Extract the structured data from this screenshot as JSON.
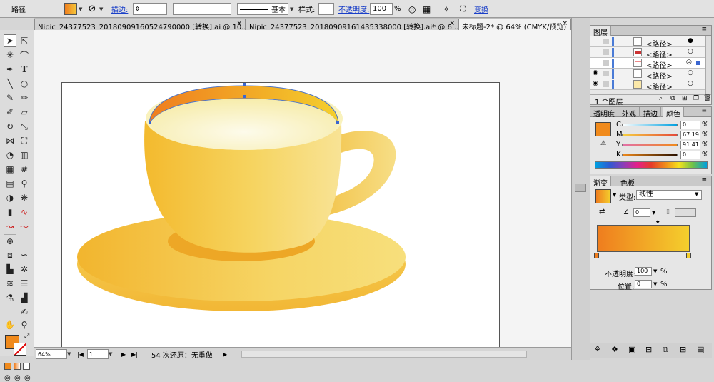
{
  "control_bar": {
    "selection_label": "路径",
    "stroke_link": "描边:",
    "stroke_style": "基本",
    "style_label": "样式:",
    "opacity_link": "不透明度:",
    "opacity_value": "100",
    "opacity_unit": "%",
    "transform_link": "变换"
  },
  "doc_tabs": [
    {
      "label": "Nipic_24377523_20180909160524790000 [转换].ai @ 10...",
      "close": "×"
    },
    {
      "label": "Nipic_24377523_20180909161435338000 [转换].ai* @ 6...",
      "close": "×"
    },
    {
      "label": "未标题-2* @ 64% (CMYK/预览)",
      "close": "×"
    }
  ],
  "status_bar": {
    "zoom": "64%",
    "page": "1",
    "history_text": "54 次还原：无重做"
  },
  "layers_panel": {
    "tab": "图层",
    "rows": [
      "<路径>",
      "<路径>",
      "<路径>",
      "<路径>",
      "<路径>"
    ],
    "footer": "1 个图层"
  },
  "color_panel": {
    "tabs": [
      "透明度",
      "外观",
      "描边",
      "颜色"
    ],
    "channels": [
      {
        "label": "C",
        "value": "0",
        "unit": "%"
      },
      {
        "label": "M",
        "value": "67.19",
        "unit": "%"
      },
      {
        "label": "Y",
        "value": "91.41",
        "unit": "%"
      },
      {
        "label": "K",
        "value": "0",
        "unit": "%"
      }
    ],
    "fill_color": "#f08a1c"
  },
  "gradient_panel": {
    "tabs": [
      "渐变",
      "色板"
    ],
    "type_label": "类型:",
    "type_value": "线性",
    "angle_value": "0",
    "opacity_label": "不透明度:",
    "opacity_value": "100",
    "opacity_unit": "%",
    "position_label": "位置:",
    "position_value": "0",
    "position_unit": "%",
    "start_color": "#ef7d1e",
    "end_color": "#f4cf2d"
  }
}
